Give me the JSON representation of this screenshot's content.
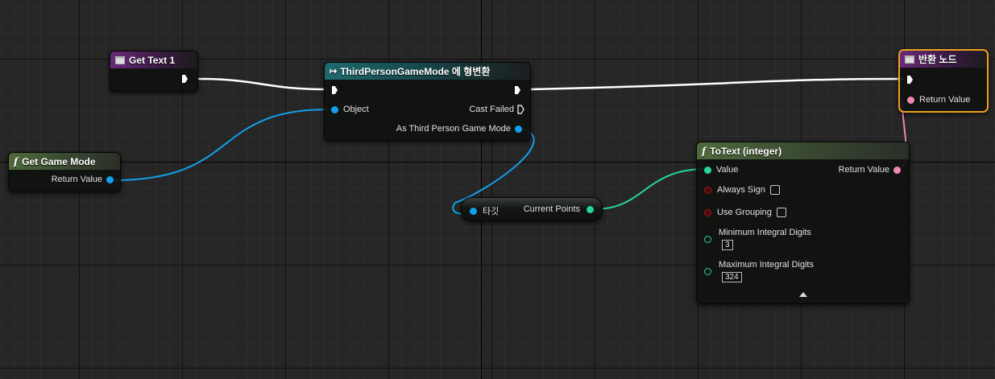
{
  "nodes": {
    "get_text": {
      "title": "Get Text 1"
    },
    "cast": {
      "title": "ThirdPersonGameMode 에 형변환",
      "object_label": "Object",
      "cast_failed_label": "Cast Failed",
      "as_label": "As Third Person Game Mode"
    },
    "get_game_mode": {
      "title": "Get Game Mode",
      "return_label": "Return Value"
    },
    "getter": {
      "target_label": "타깃",
      "output_label": "Current Points"
    },
    "to_text": {
      "title": "ToText (integer)",
      "value_label": "Value",
      "return_label": "Return Value",
      "always_sign_label": "Always Sign",
      "use_grouping_label": "Use Grouping",
      "min_digits_label": "Minimum Integral Digits",
      "min_digits_value": "3",
      "max_digits_label": "Maximum Integral Digits",
      "max_digits_value": "324"
    },
    "return_node": {
      "title": "반환 노드",
      "return_label": "Return Value"
    }
  },
  "colors": {
    "object_pin": "#12a0ea",
    "integer_pin": "#27d4a0",
    "text_pin": "#ef88b6",
    "exec_wire": "#ffffff",
    "selection": "#f0a020"
  }
}
